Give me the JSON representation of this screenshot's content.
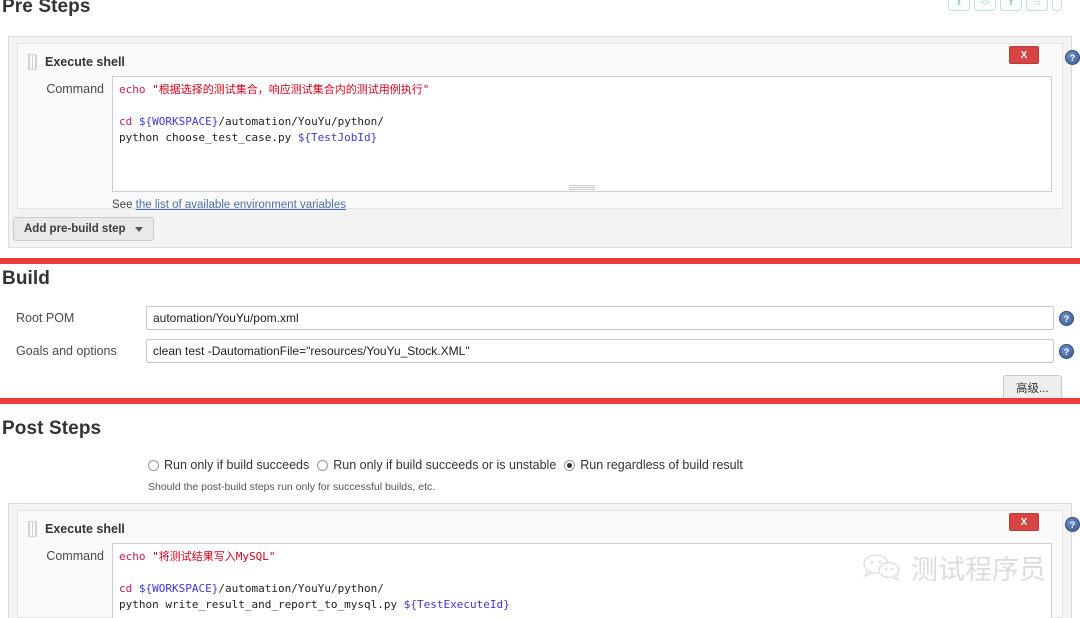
{
  "toolbar": {
    "icons": [
      "download-icon",
      "code-icon",
      "upload-icon",
      "folder-icon",
      "more-icon"
    ]
  },
  "pre_steps": {
    "title": "Pre Steps",
    "builder": {
      "name": "Execute shell",
      "remove_label": "X",
      "help_label": "?",
      "command_label": "Command",
      "command_lines": [
        {
          "segments": [
            {
              "t": "echo ",
              "c": "kw"
            },
            {
              "t": "\"根据选择的测试集合，响应测试集合内的测试用例执行\"",
              "c": "str"
            }
          ]
        },
        {
          "segments": [
            {
              "t": "",
              "c": "plain"
            }
          ]
        },
        {
          "segments": [
            {
              "t": "cd ",
              "c": "kw"
            },
            {
              "t": "${WORKSPACE}",
              "c": "var"
            },
            {
              "t": "/automation/YouYu/python/",
              "c": "plain"
            }
          ]
        },
        {
          "segments": [
            {
              "t": "python choose_test_case.py ",
              "c": "plain"
            },
            {
              "t": "${TestJobId}",
              "c": "var"
            }
          ]
        }
      ],
      "hint_prefix": "See ",
      "hint_link": "the list of available environment variables"
    },
    "add_step_label": "Add pre-build step"
  },
  "build": {
    "title": "Build",
    "root_pom": {
      "label": "Root POM",
      "value": "automation/YouYu/pom.xml",
      "help_label": "?"
    },
    "goals": {
      "label": "Goals and options",
      "value": "clean test -DautomationFile=\"resources/YouYu_Stock.XML\"",
      "help_label": "?"
    },
    "advanced_label": "高级..."
  },
  "post_steps": {
    "title": "Post Steps",
    "run_conditions": [
      {
        "label": "Run only if build succeeds",
        "selected": false
      },
      {
        "label": "Run only if build succeeds or is unstable",
        "selected": false
      },
      {
        "label": "Run regardless of build result",
        "selected": true
      }
    ],
    "hint": "Should the post-build steps run only for successful builds, etc.",
    "builder": {
      "name": "Execute shell",
      "remove_label": "X",
      "help_label": "?",
      "command_label": "Command",
      "command_lines": [
        {
          "segments": [
            {
              "t": "echo ",
              "c": "kw"
            },
            {
              "t": "\"将测试结果写入MySQL\"",
              "c": "str"
            }
          ]
        },
        {
          "segments": [
            {
              "t": "",
              "c": "plain"
            }
          ]
        },
        {
          "segments": [
            {
              "t": "cd ",
              "c": "kw"
            },
            {
              "t": "${WORKSPACE}",
              "c": "var"
            },
            {
              "t": "/automation/YouYu/python/",
              "c": "plain"
            }
          ]
        },
        {
          "segments": [
            {
              "t": "python write_result_and_report_to_mysql.py ",
              "c": "plain"
            },
            {
              "t": "${TestExecuteId}",
              "c": "var"
            }
          ]
        }
      ]
    }
  },
  "watermark": {
    "text": "测试程序员",
    "icon": "wechat-icon"
  },
  "colors": {
    "divider_red": "#ee3b3b",
    "remove_red": "#d64541",
    "help_blue": "#3b5c96",
    "link_blue": "#4a6fa5",
    "panel_grey": "#f3f3f3"
  }
}
